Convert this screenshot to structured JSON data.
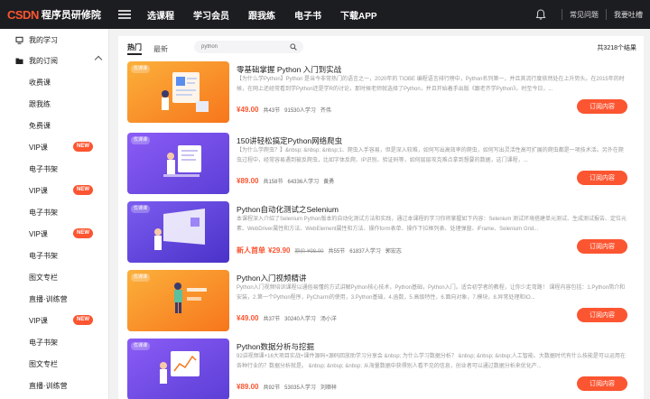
{
  "header": {
    "logo_mark": "CSDN",
    "logo_sub": "程序员研修院",
    "nav": [
      "选课程",
      "学习会员",
      "跟我练",
      "电子书",
      "下载APP"
    ],
    "links": [
      "常见问题",
      "我要吐槽"
    ]
  },
  "sidebar": {
    "items": [
      {
        "label": "我的学习",
        "icon": "monitor-icon",
        "new": false,
        "chevron": false
      },
      {
        "label": "我的订阅",
        "icon": "folder-icon",
        "new": false,
        "chevron": true
      },
      {
        "label": "收费课",
        "new": false
      },
      {
        "label": "跟我练",
        "new": false
      },
      {
        "label": "免费课",
        "new": false
      },
      {
        "label": "VIP课",
        "new": true
      },
      {
        "label": "电子书架",
        "new": false
      },
      {
        "label": "VIP课",
        "new": true
      },
      {
        "label": "电子书架",
        "new": false
      },
      {
        "label": "VIP课",
        "new": true
      },
      {
        "label": "电子书架",
        "new": false
      },
      {
        "label": "图文专栏",
        "new": false
      },
      {
        "label": "直播·训练营",
        "new": false
      },
      {
        "label": "VIP课",
        "new": true
      },
      {
        "label": "电子书架",
        "new": false
      },
      {
        "label": "图文专栏",
        "new": false
      },
      {
        "label": "直播·训练营",
        "new": false
      }
    ],
    "new_badge": "NEW"
  },
  "main": {
    "tabs": [
      "热门",
      "最新"
    ],
    "search_placeholder": "python",
    "total": "共3218个结果",
    "btn_label": "订阅内容",
    "thumb_badge": "优课课",
    "courses": [
      {
        "title": "零基础掌握 Python 入门到实战",
        "desc": "【为什么学Python】Python 是当今非常热门的语言之一，2020年的 TIOBE 编程语言排行榜中，Python名列第一，并且其流行度依然处在上升势头。在2015年的时候，在网上还经常看到学Python还是学R的讨论，那时候老师就选择了Python，并且开始着手出版《跟老齐学Python》。时至今日，...",
        "price_label": "",
        "price": "¥49.00",
        "old_price": "",
        "meta": [
          "共43节",
          "91530人学习",
          "齐伟"
        ],
        "theme": "orange"
      },
      {
        "title": "150讲轻松搞定Python网络爬虫",
        "desc": "【为什么学爬虫？】&nbsp; &nbsp; &nbsp;1、爬虫入手容易，但是深入较难，如何写出高效率的爬虫，如何写出灵活性高可扩展的爬虫都是一项技术活。另外在爬虫过程中，经常容易遇到被反爬虫，比如字体反爬、IP识别、验证码等，如何层层攻克难点拿到想要的数据，这门课程，...",
        "price_label": "",
        "price": "¥89.00",
        "old_price": "",
        "meta": [
          "共158节",
          "64336人学习",
          "黄勇"
        ],
        "theme": "purple"
      },
      {
        "title": "Python自动化测试之Selenium",
        "desc": "本课程深入介绍了Selenium Python版本的自动化测试方法和实践，通过本课程的学习你将掌握如下内容：Selenium 测试环境搭建单元测试、生成测试报告、定位元素、WebDriver属性和方法、WebElement属性和方法、操作form表单、操作下拉框列表、处理弹窗、iFrame、Selenium Grid...",
        "price_label": "新人首单",
        "price": "¥29.90",
        "old_price": "原价 ¥98.00",
        "meta": [
          "共55节",
          "61837人学习",
          "郭宏志"
        ],
        "theme": "purple"
      },
      {
        "title": "Python入门视频精讲",
        "desc": "Python入门视频培训课程以通俗易懂的方式讲解Python核心技术，Python基础，Python入门。适合初学者的教程，让你少走弯路！ 课程内容包括：1.Python简介和安装，2.第一个Python程序，PyCharm的使用，3.Python基础，4.函数，5.高级特性，6.面向对象，7.模块，8.异常处理和IO...",
        "price_label": "",
        "price": "¥49.00",
        "old_price": "",
        "meta": [
          "共37节",
          "30240人学习",
          "汤小洋"
        ],
        "theme": "orange"
      },
      {
        "title": "Python数据分析与挖掘",
        "desc": "92讲视频课+16大项目实战+课件源码+源码回放助学习分享会 &nbsp; 为什么学习数据分析？ &nbsp; &nbsp; &nbsp;人工智能、大数据时代有什么技能是可以运用在各种行业的？数据分析就是。 &nbsp; &nbsp; &nbsp; 从海量数据中获得别人看不见的信息，创业者可以通过数据分析来优化产...",
        "price_label": "",
        "price": "¥89.00",
        "old_price": "",
        "meta": [
          "共92节",
          "53035人学习",
          "刘顺祥"
        ],
        "theme": "purple"
      }
    ]
  },
  "colors": {
    "accent": "#fc5531",
    "topbar": "#1c1d21",
    "orange_thumb": "#f99a2b",
    "purple_thumb": "#6a48e0"
  }
}
